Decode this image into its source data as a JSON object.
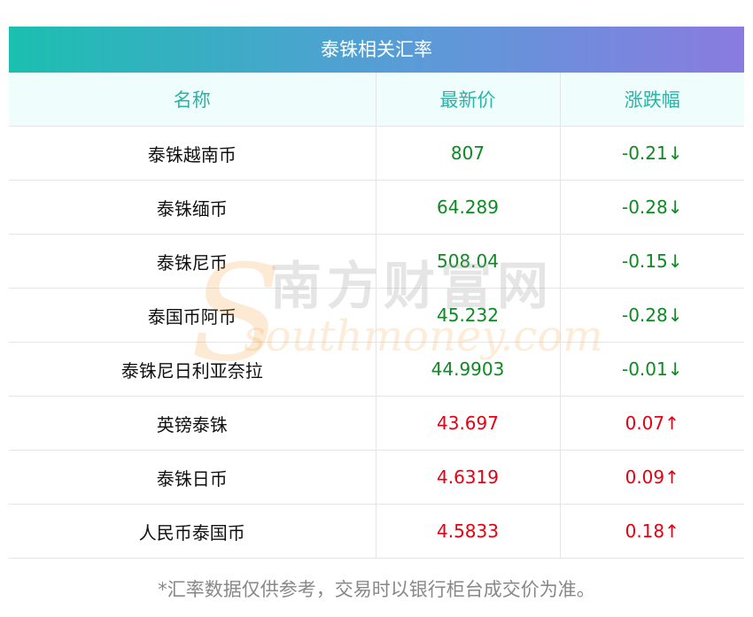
{
  "table": {
    "title": "泰铢相关汇率",
    "headers": {
      "name": "名称",
      "price": "最新价",
      "change": "涨跌幅"
    },
    "rows": [
      {
        "name": "泰铢越南币",
        "price": "807",
        "change": "-0.21↓",
        "direction": "down"
      },
      {
        "name": "泰铢缅币",
        "price": "64.289",
        "change": "-0.28↓",
        "direction": "down"
      },
      {
        "name": "泰铢尼币",
        "price": "508.04",
        "change": "-0.15↓",
        "direction": "down"
      },
      {
        "name": "泰国币阿币",
        "price": "45.232",
        "change": "-0.28↓",
        "direction": "down"
      },
      {
        "name": "泰铢尼日利亚奈拉",
        "price": "44.9903",
        "change": "-0.01↓",
        "direction": "down"
      },
      {
        "name": "英镑泰铢",
        "price": "43.697",
        "change": "0.07↑",
        "direction": "up"
      },
      {
        "name": "泰铢日币",
        "price": "4.6319",
        "change": "0.09↑",
        "direction": "up"
      },
      {
        "name": "人民币泰国币",
        "price": "4.5833",
        "change": "0.18↑",
        "direction": "up"
      }
    ]
  },
  "footnote": "*汇率数据仅供参考，交易时以银行柜台成交价为准。",
  "watermark": {
    "cn": "南方财富网",
    "en": "southmoney.com",
    "mark": "S"
  },
  "colors": {
    "down": "#0d8a22",
    "up": "#e60012",
    "header_text": "#2bb3a6",
    "gradient_start": "#1bbfb0",
    "gradient_end": "#8a7be0"
  }
}
